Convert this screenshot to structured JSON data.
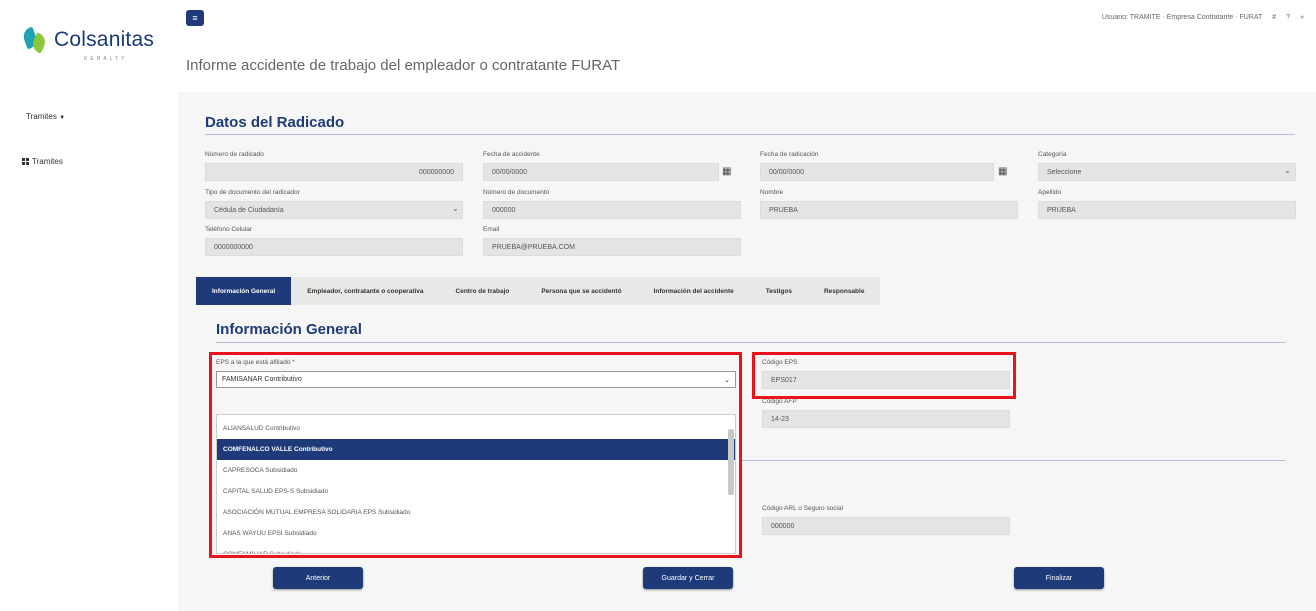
{
  "brand": {
    "name": "Colsanitas",
    "tagline": "KERALTY"
  },
  "sidebar": {
    "dropdown_label": "Tramites",
    "dropdown_arrow": "▼",
    "items": [
      {
        "label": "Tramites"
      }
    ]
  },
  "header": {
    "hamburger": "≡",
    "user_text": "Usuario: TRAMITE · Empresa Contratante · FURAT",
    "icons": [
      "#",
      "?",
      "»"
    ],
    "page_title": "Informe accidente de trabajo del empleador o contratante FURAT"
  },
  "radicado": {
    "title": "Datos del Radicado",
    "fields": {
      "numero_radicado": {
        "label": "Número de radicado",
        "value": "000000000"
      },
      "fecha_accidente": {
        "label": "Fecha de accidente",
        "value": "00/00/0000"
      },
      "fecha_radicacion": {
        "label": "Fecha de radicación",
        "value": "00/00/0000"
      },
      "categoria": {
        "label": "Categoría",
        "value": "Seleccione"
      },
      "tipo_documento": {
        "label": "Tipo de documento del radicador",
        "value": "Cédula de Ciudadanía"
      },
      "numero_documento": {
        "label": "Número de documento",
        "value": "000000"
      },
      "nombre": {
        "label": "Nombre",
        "value": "PRUEBA"
      },
      "apellido": {
        "label": "Apellido",
        "value": "PRUEBA"
      },
      "telefono": {
        "label": "Teléfono Celular",
        "value": "0000000000"
      },
      "email": {
        "label": "Email",
        "value": "PRUEBA@PRUEBA.COM"
      }
    },
    "calendar_icon": "▦",
    "chevron_icon": "⌄"
  },
  "tabs": [
    {
      "label": "Información General",
      "active": true
    },
    {
      "label": "Empleador, contratante o cooperativa",
      "active": false
    },
    {
      "label": "Centro de trabajo",
      "active": false
    },
    {
      "label": "Persona que se accidentó",
      "active": false
    },
    {
      "label": "Información del accidente",
      "active": false
    },
    {
      "label": "Testigos",
      "active": false
    },
    {
      "label": "Responsable",
      "active": false
    }
  ],
  "info_general": {
    "title": "Información General",
    "eps_label": "EPS a la que está afiliado *",
    "eps_selected": "FAMISANAR Contributivo",
    "eps_options": [
      {
        "label": "ALIANSALUD Contributivo",
        "selected": false
      },
      {
        "label": "COMFENALCO VALLE Contributivo",
        "selected": true
      },
      {
        "label": "CAPRESOCA Subsidiado",
        "selected": false
      },
      {
        "label": "CAPITAL SALUD EPS-S Subsidiado",
        "selected": false
      },
      {
        "label": "ASOCIACIÓN MUTUAL EMPRESA SOLIDARIA EPS Subsidiado",
        "selected": false
      },
      {
        "label": "ANAS WAYUU EPSI Subsidiado",
        "selected": false
      },
      {
        "label": "COMFAMILIAR Subsidiado",
        "selected": false
      }
    ],
    "codigo_eps_label": "Código EPS",
    "codigo_eps_value": "EPS017",
    "codigo_afp_label": "Código AFP",
    "codigo_afp_value": "14-23",
    "codigo_arl_label": "Código ARL o Seguro social",
    "codigo_arl_value": "000000"
  },
  "buttons": {
    "previous": "Anterior",
    "save_close": "Guardar y Cerrar",
    "finish": "Finalizar"
  },
  "colors": {
    "primary": "#1e3a78",
    "highlight": "#e8141b",
    "panel": "#f6f6f6"
  }
}
